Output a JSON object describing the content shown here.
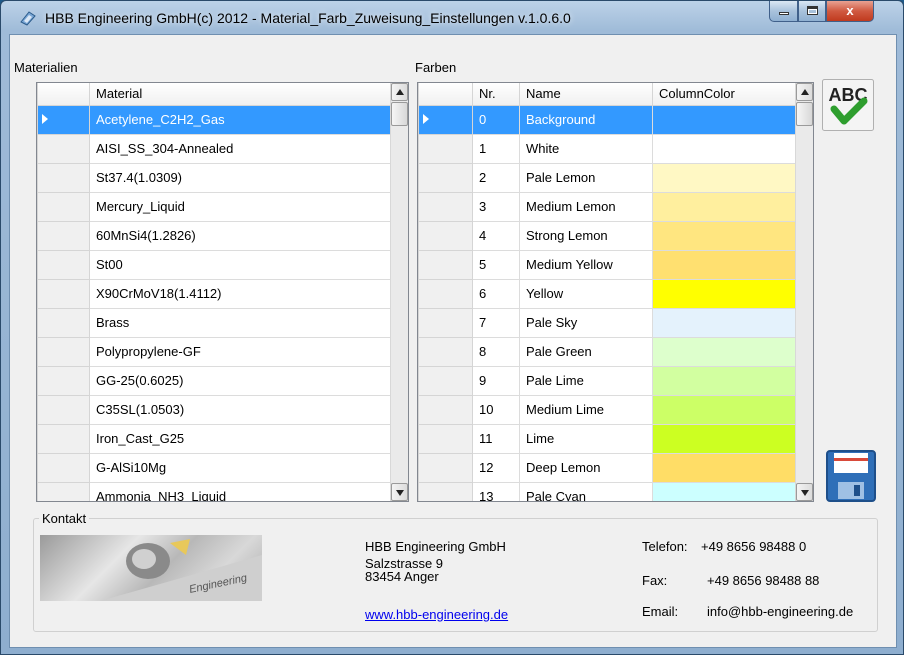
{
  "window": {
    "title": "HBB Engineering GmbH(c) 2012 - Material_Farb_Zuweisung_Einstellungen v.1.0.6.0",
    "min_glyph": "",
    "close_glyph": "x"
  },
  "materials": {
    "group_label": "Materialien",
    "column_header": "Material",
    "rows": [
      "Acetylene_C2H2_Gas",
      "AISI_SS_304-Annealed",
      "St37.4(1.0309)",
      "Mercury_Liquid",
      "60MnSi4(1.2826)",
      "St00",
      "X90CrMoV18(1.4112)",
      "Brass",
      "Polypropylene-GF",
      "GG-25(0.6025)",
      "C35SL(1.0503)",
      "Iron_Cast_G25",
      "G-AlSi10Mg",
      "Ammonia_NH3_Liquid"
    ]
  },
  "colors": {
    "group_label": "Farben",
    "headers": {
      "nr": "Nr.",
      "name": "Name",
      "color": "ColumnColor"
    },
    "rows": [
      {
        "nr": "0",
        "name": "Background",
        "swatch": "#3399ff"
      },
      {
        "nr": "1",
        "name": "White",
        "swatch": "#ffffff"
      },
      {
        "nr": "2",
        "name": "Pale Lemon",
        "swatch": "#fff8c4"
      },
      {
        "nr": "3",
        "name": "Medium Lemon",
        "swatch": "#ffef9e"
      },
      {
        "nr": "4",
        "name": "Strong Lemon",
        "swatch": "#ffe680"
      },
      {
        "nr": "5",
        "name": "Medium Yellow",
        "swatch": "#ffe070"
      },
      {
        "nr": "6",
        "name": "Yellow",
        "swatch": "#ffff00"
      },
      {
        "nr": "7",
        "name": "Pale Sky",
        "swatch": "#e4f2fc"
      },
      {
        "nr": "8",
        "name": "Pale Green",
        "swatch": "#ddffcc"
      },
      {
        "nr": "9",
        "name": "Pale Lime",
        "swatch": "#d2ffa0"
      },
      {
        "nr": "10",
        "name": "Medium Lime",
        "swatch": "#ccff66"
      },
      {
        "nr": "11",
        "name": "Lime",
        "swatch": "#ccff22"
      },
      {
        "nr": "12",
        "name": "Deep Lemon",
        "swatch": "#ffdd66"
      },
      {
        "nr": "13",
        "name": "Pale Cyan",
        "swatch": "#ccffff"
      }
    ]
  },
  "buttons": {
    "spellcheck_icon": "abc-check-icon",
    "spellcheck_text": "ABC",
    "save_icon": "floppy-disk-icon"
  },
  "contact": {
    "group_label": "Kontakt",
    "logo_text": "Engineering",
    "company": "HBB Engineering GmbH",
    "street": "Salzstrasse 9",
    "city": "83454 Anger",
    "website": "www.hbb-engineering.de",
    "phone_label": "Telefon:",
    "phone": "+49 8656 98488 0",
    "fax_label": "Fax:",
    "fax": "+49 8656 98488 88",
    "email_label": "Email:",
    "email": "info@hbb-engineering.de"
  },
  "colors_theme": {
    "selection": "#3399ff",
    "check_green": "#2e9e2e",
    "title_bar": "#9fbbd8"
  }
}
